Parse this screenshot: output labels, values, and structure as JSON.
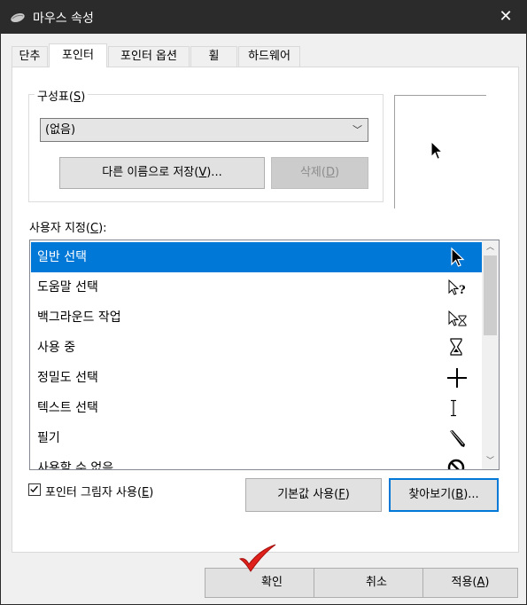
{
  "window": {
    "title": "마우스 속성",
    "close_glyph": "✕"
  },
  "tabs": [
    {
      "label": "단추"
    },
    {
      "label": "포인터"
    },
    {
      "label": "포인터 옵션"
    },
    {
      "label": "휠"
    },
    {
      "label": "하드웨어"
    }
  ],
  "scheme": {
    "label": "구성표(S)",
    "selected": "(없음)",
    "save_as": "다른 이름으로 저장(V)...",
    "delete": "삭제(D)"
  },
  "custom": {
    "label": "사용자 지정(C):",
    "items": [
      {
        "label": "일반 선택",
        "icon": "arrow-cursor-icon"
      },
      {
        "label": "도움말 선택",
        "icon": "help-cursor-icon"
      },
      {
        "label": "백그라운드 작업",
        "icon": "working-cursor-icon"
      },
      {
        "label": "사용 중",
        "icon": "hourglass-icon"
      },
      {
        "label": "정밀도 선택",
        "icon": "crosshair-icon"
      },
      {
        "label": "텍스트 선택",
        "icon": "ibeam-icon"
      },
      {
        "label": "필기",
        "icon": "pen-icon"
      },
      {
        "label": "사용할 수 없음",
        "icon": "unavailable-icon"
      }
    ]
  },
  "shadow": {
    "label": "포인터 그림자 사용(E)",
    "checked": true,
    "mark": "✓"
  },
  "buttons": {
    "default": "기본값 사용(F)",
    "browse": "찾아보기(B)...",
    "ok": "확인",
    "cancel": "취소",
    "apply": "적용(A)"
  },
  "colors": {
    "accent": "#0078d7",
    "titlebar": "#2b2b2b",
    "checkmark": "#e0201b"
  }
}
